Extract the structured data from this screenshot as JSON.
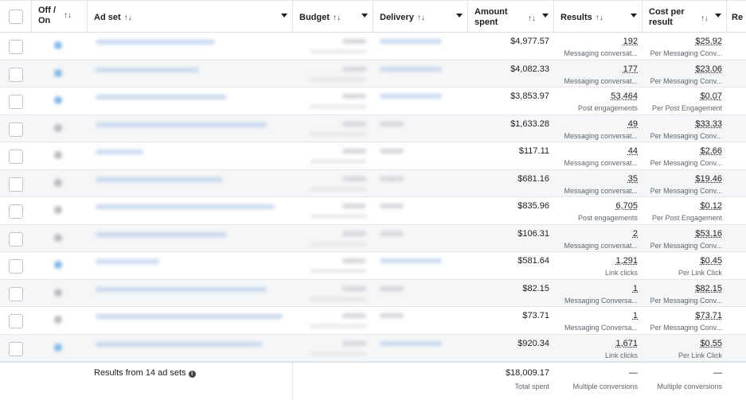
{
  "header": {
    "off_on_line1": "Off /",
    "off_on_line2": "On",
    "ad_set": "Ad set",
    "budget": "Budget",
    "delivery": "Delivery",
    "amount_line1": "Amount",
    "amount_line2": "spent",
    "results": "Results",
    "cost_line1": "Cost per",
    "cost_line2": "result",
    "re": "Re",
    "sort_glyph": "↑↓"
  },
  "rows": [
    {
      "amount": "$4,977.57",
      "results": "192",
      "result_type": "Messaging conversat...",
      "cost": "$25.92",
      "cost_type": "Per Messaging Conv...",
      "status": "on"
    },
    {
      "amount": "$4,082.33",
      "results": "177",
      "result_type": "Messaging conversat...",
      "cost": "$23.06",
      "cost_type": "Per Messaging Conv...",
      "status": "on"
    },
    {
      "amount": "$3,853.97",
      "results": "53,464",
      "result_type": "Post engagements",
      "cost": "$0.07",
      "cost_type": "Per Post Engagement",
      "status": "on"
    },
    {
      "amount": "$1,633.28",
      "results": "49",
      "result_type": "Messaging conversat...",
      "cost": "$33.33",
      "cost_type": "Per Messaging Conv...",
      "status": "off"
    },
    {
      "amount": "$117.11",
      "results": "44",
      "result_type": "Messaging conversat...",
      "cost": "$2.66",
      "cost_type": "Per Messaging Conv...",
      "status": "off"
    },
    {
      "amount": "$681.16",
      "results": "35",
      "result_type": "Messaging conversat...",
      "cost": "$19.46",
      "cost_type": "Per Messaging Conv...",
      "status": "off"
    },
    {
      "amount": "$835.96",
      "results": "6,705",
      "result_type": "Post engagements",
      "cost": "$0.12",
      "cost_type": "Per Post Engagement",
      "status": "off"
    },
    {
      "amount": "$106.31",
      "results": "2",
      "result_type": "Messaging conversat...",
      "cost": "$53.16",
      "cost_type": "Per Messaging Conv...",
      "status": "off"
    },
    {
      "amount": "$581.64",
      "results": "1,291",
      "result_type": "Link clicks",
      "cost": "$0.45",
      "cost_type": "Per Link Click",
      "status": "on"
    },
    {
      "amount": "$82.15",
      "results": "1",
      "result_type": "Messaging Conversa...",
      "cost": "$82.15",
      "cost_type": "Per Messaging Conv...",
      "status": "off"
    },
    {
      "amount": "$73.71",
      "results": "1",
      "result_type": "Messaging Conversa...",
      "cost": "$73.71",
      "cost_type": "Per Messaging Conv...",
      "status": "off"
    },
    {
      "amount": "$920.34",
      "results": "1,671",
      "result_type": "Link clicks",
      "cost": "$0.55",
      "cost_type": "Per Link Click",
      "status": "on"
    }
  ],
  "footer": {
    "label": "Results from 14 ad sets",
    "info_icon": "info-icon",
    "amount": "$18,009.17",
    "amount_sub": "Total spent",
    "results": "—",
    "results_sub": "Multiple conversions",
    "cost": "—",
    "cost_sub": "Multiple conversions"
  }
}
